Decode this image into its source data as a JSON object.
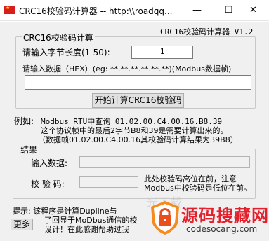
{
  "window": {
    "title": "CRC16校验码计算器 -- http:\\\\roadqq...",
    "min_glyph": "—",
    "max_glyph": "☐",
    "close_glyph": "✕"
  },
  "app": {
    "heading": "CRC16校验码计算器 V1.2"
  },
  "calc_group": {
    "legend": "CRC16校验码计算",
    "length_label": "请输入字节长度(1-50):",
    "length_value": "1",
    "data_label": "请输入数据（HEX）(eg: **.**.**.**.**.**)(Modbus数据帧)",
    "data_value": "",
    "compute_button": "开始计算CRC16校验码"
  },
  "example": {
    "prefix": "例如:",
    "line1": "Modbus RTU中查询 01.02.00.C4.00.16.B8.39",
    "line2": "这个协议帧中的最后2字节B8和39是需要计算出来的。",
    "line3": "（数据帧01.02.00.C4.00.16其校验码计算结果为39B8）"
  },
  "result_group": {
    "legend": "结果",
    "input_label": "输入数据:",
    "input_value": "",
    "crc_label": "校 验 码:",
    "crc_value": "",
    "note_line1": "此处校验码高位在前，注意",
    "note_line2": "Modbus中校验码是低位在前。"
  },
  "footer": {
    "tip_line1": "提示: 该程序是计算Dupline与",
    "tip_line2": "了回显于MoDbus通信的校",
    "tip_line3": "设计！在此感谢帮助过我",
    "more_button": "更多"
  },
  "watermark": {
    "main": "源码搜藏网",
    "url": "codesocang.com",
    "faded": "光下载"
  }
}
